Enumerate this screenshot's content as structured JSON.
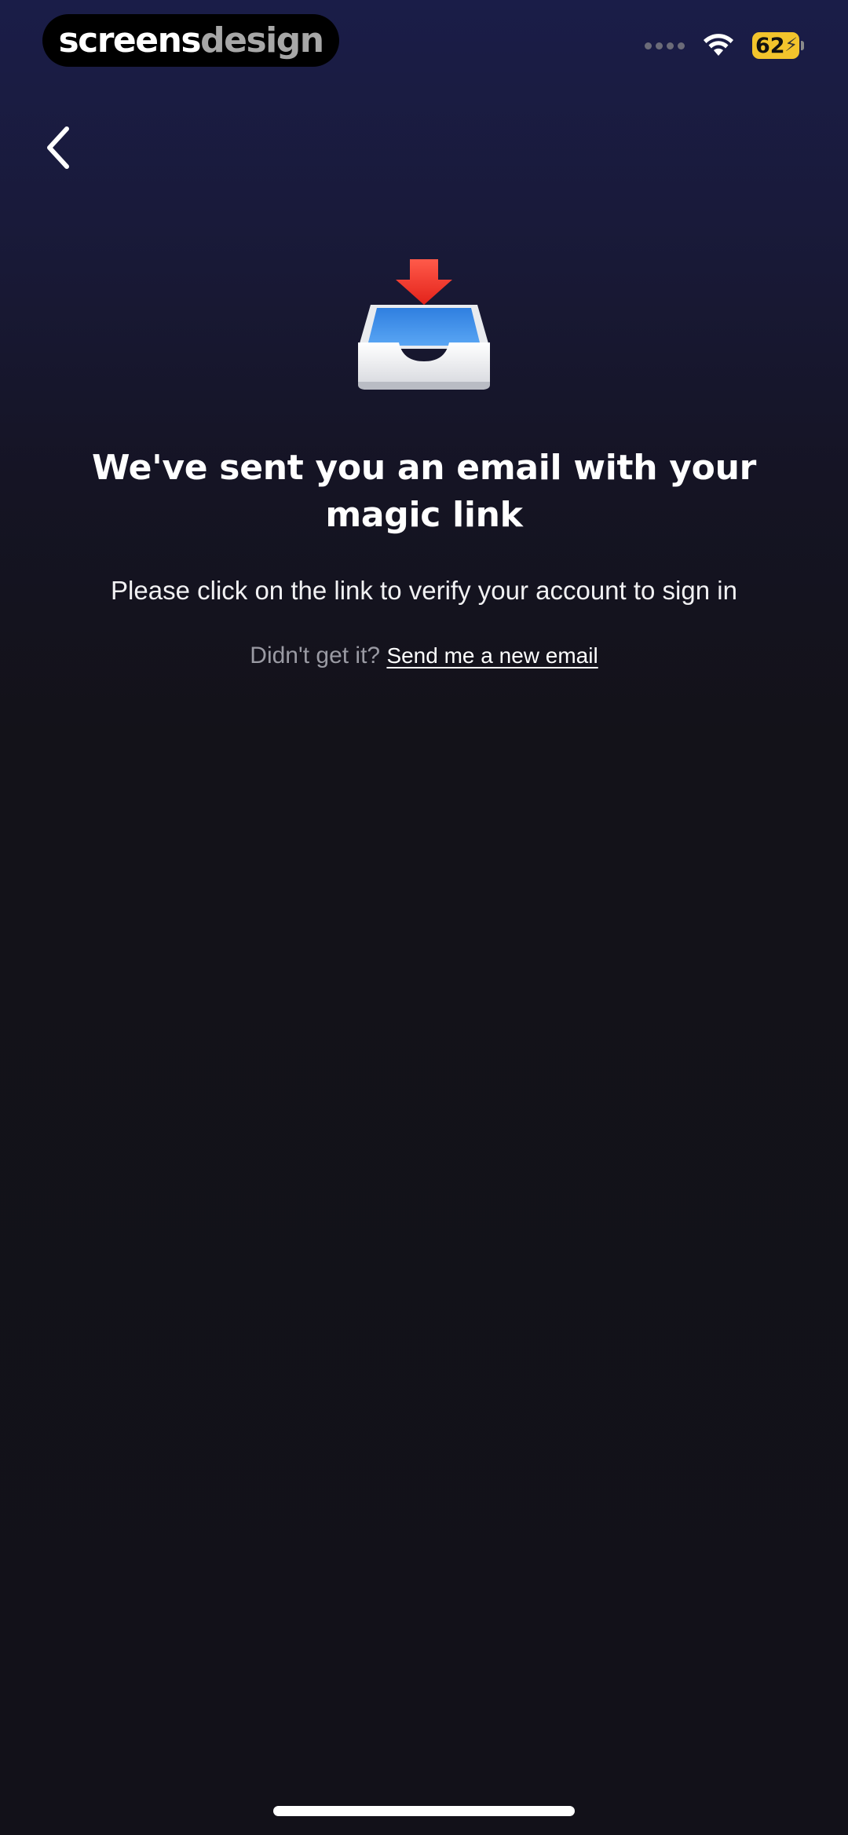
{
  "status_bar": {
    "brand_primary": "screens",
    "brand_secondary": "design",
    "battery_level": "62",
    "battery_color": "#f2c42c",
    "wifi_icon": "wifi-icon",
    "signal_icon": "signal-dots-icon"
  },
  "nav": {
    "back_icon": "chevron-left-icon"
  },
  "illustration": {
    "icon": "inbox-tray-download-icon"
  },
  "content": {
    "headline": "We've sent you an email with your magic link",
    "subtext": "Please click on the link to verify your account to sign in",
    "resend_prompt": "Didn't get it?",
    "resend_link": "Send me a new email"
  },
  "colors": {
    "background_top": "#1a1d48",
    "background_bottom": "#121119",
    "text_primary": "#ffffff",
    "text_muted": "#9a9aa3"
  }
}
